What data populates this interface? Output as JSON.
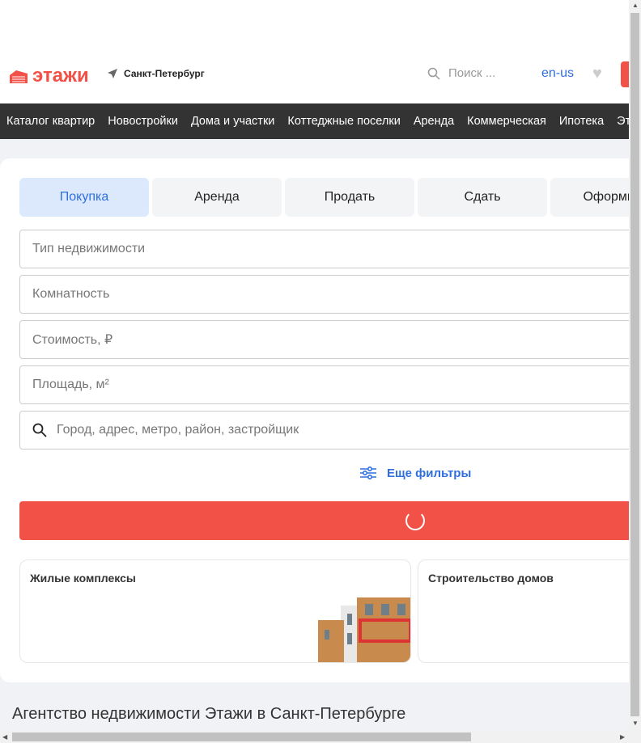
{
  "header": {
    "logo": "этажи",
    "city": "Санкт-Петербург",
    "search_placeholder": "Поиск ...",
    "lang": "en-us"
  },
  "nav": [
    "Каталог квартир",
    "Новостройки",
    "Дома и участки",
    "Коттеджные поселки",
    "Аренда",
    "Коммерческая",
    "Ипотека",
    "Эт"
  ],
  "tabs": [
    "Покупка",
    "Аренда",
    "Продать",
    "Сдать",
    "Оформить"
  ],
  "fields": {
    "type": "Тип недвижимости",
    "rooms": "Комнатность",
    "price": "Стоимость, ₽",
    "area": "Площадь, м²",
    "location": "Город, адрес, метро, район, застройщик"
  },
  "more_filters": "Еще фильтры",
  "tiles": [
    "Жилые комплексы",
    "Строительство домов"
  ],
  "section_title": "Агентство недвижимости Этажи в Санкт-Петербурге",
  "colors": {
    "brand": "#f25148",
    "accent": "#2f6fe0"
  }
}
